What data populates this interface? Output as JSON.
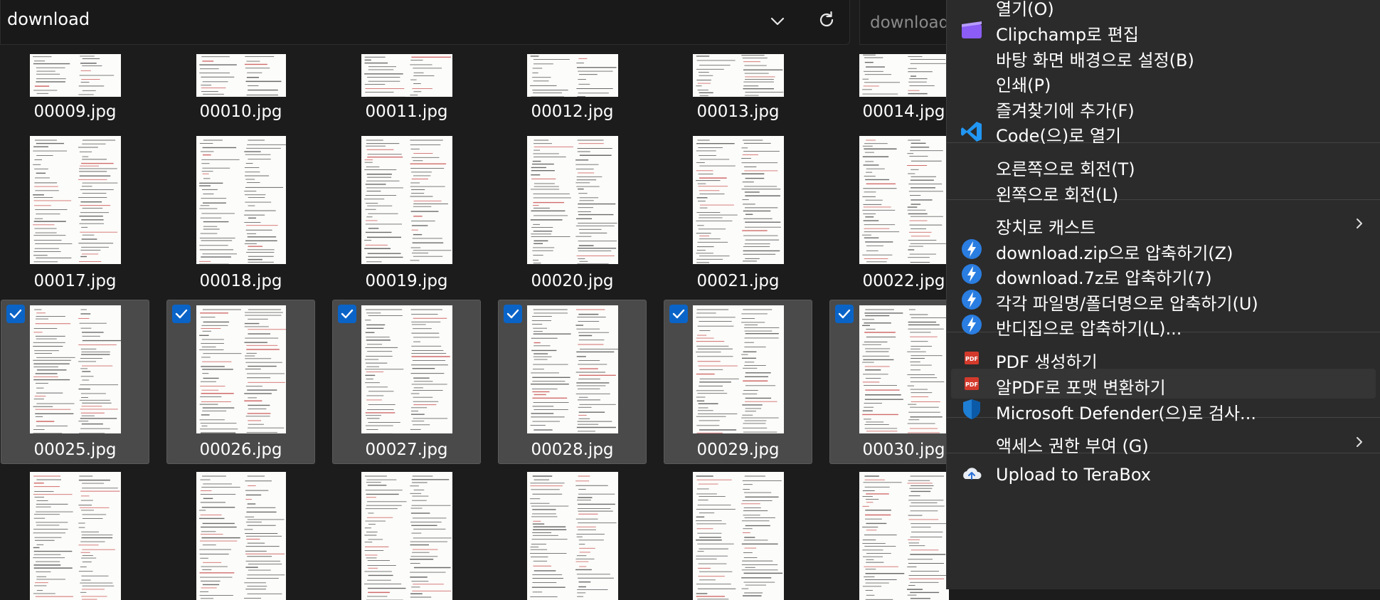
{
  "address_bar": {
    "path": "download"
  },
  "search": {
    "placeholder": "download"
  },
  "files": [
    {
      "name": "00009.jpg",
      "selected": false
    },
    {
      "name": "00010.jpg",
      "selected": false
    },
    {
      "name": "00011.jpg",
      "selected": false
    },
    {
      "name": "00012.jpg",
      "selected": false
    },
    {
      "name": "00013.jpg",
      "selected": false
    },
    {
      "name": "00014.jpg",
      "selected": false
    },
    {
      "name": "00017.jpg",
      "selected": false
    },
    {
      "name": "00018.jpg",
      "selected": false
    },
    {
      "name": "00019.jpg",
      "selected": false
    },
    {
      "name": "00020.jpg",
      "selected": false
    },
    {
      "name": "00021.jpg",
      "selected": false
    },
    {
      "name": "00022.jpg",
      "selected": false
    },
    {
      "name": "00025.jpg",
      "selected": true
    },
    {
      "name": "00026.jpg",
      "selected": true
    },
    {
      "name": "00027.jpg",
      "selected": true
    },
    {
      "name": "00028.jpg",
      "selected": true
    },
    {
      "name": "00029.jpg",
      "selected": true
    },
    {
      "name": "00030.jpg",
      "selected": true
    },
    {
      "name": "",
      "selected": false
    },
    {
      "name": "",
      "selected": false
    },
    {
      "name": "",
      "selected": false
    },
    {
      "name": "",
      "selected": false
    },
    {
      "name": "",
      "selected": false
    },
    {
      "name": "",
      "selected": false
    }
  ],
  "context_menu": {
    "items": [
      {
        "label": "열기(O)",
        "icon": "none"
      },
      {
        "label": "Clipchamp로 편집",
        "icon": "clipchamp-icon"
      },
      {
        "label": "바탕 화면 배경으로 설정(B)",
        "icon": "none"
      },
      {
        "label": "인쇄(P)",
        "icon": "none"
      },
      {
        "label": "즐겨찾기에 추가(F)",
        "icon": "none"
      },
      {
        "label": "Code(으)로 열기",
        "icon": "vscode-icon"
      },
      {
        "label": "오른쪽으로 회전(T)",
        "icon": "none"
      },
      {
        "label": "왼쪽으로 회전(L)",
        "icon": "none"
      },
      {
        "label": "장치로 캐스트",
        "icon": "none",
        "submenu": true
      },
      {
        "label": "download.zip으로 압축하기(Z)",
        "icon": "bandizip-icon"
      },
      {
        "label": "download.7z로 압축하기(7)",
        "icon": "bandizip-icon"
      },
      {
        "label": "각각 파일명/폴더명으로 압축하기(U)",
        "icon": "bandizip-icon"
      },
      {
        "label": "반디집으로 압축하기(L)...",
        "icon": "bandizip-icon"
      },
      {
        "label": "PDF 생성하기",
        "icon": "pdf-icon"
      },
      {
        "label": "알PDF로 포맷 변환하기",
        "icon": "pdf-icon",
        "hovered": true
      },
      {
        "label": "Microsoft Defender(으)로 검사...",
        "icon": "defender-shield-icon"
      },
      {
        "label": "액세스 권한 부여 (G)",
        "icon": "none",
        "submenu": true
      },
      {
        "label": "Upload to TeraBox",
        "icon": "terabox-icon"
      }
    ]
  },
  "colors": {
    "background": "#1c1c1c",
    "selection": "#4a4a4a",
    "checkbox": "#0a64c8",
    "menu": "#2b2b2b",
    "bandizip": "#2a7de1",
    "pdf": "#d33a2c",
    "defender": "#1f7fd4",
    "clipchamp": "#8b5cf6",
    "vscode": "#2196f3"
  }
}
